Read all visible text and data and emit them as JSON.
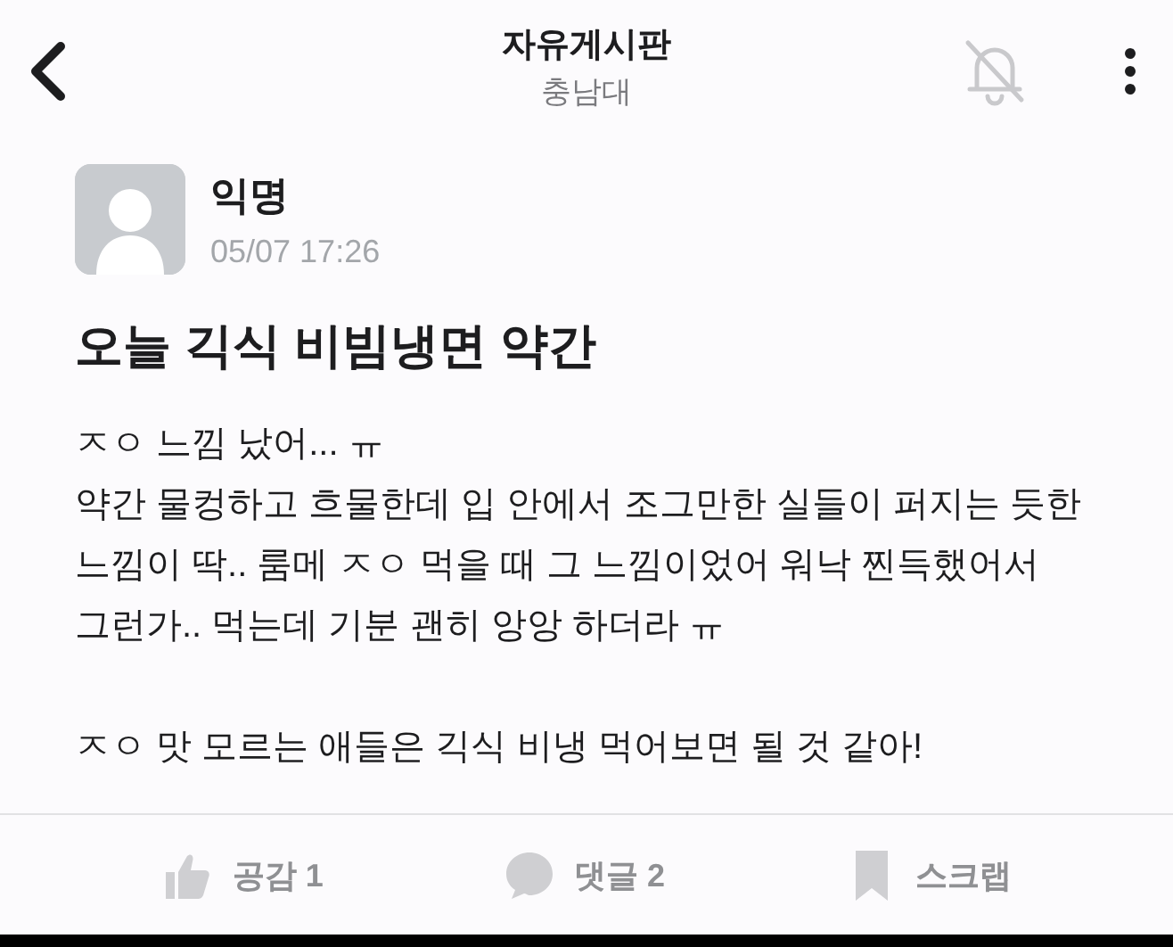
{
  "header": {
    "title": "자유게시판",
    "subtitle": "충남대",
    "notifications_muted": true
  },
  "post": {
    "author": "익명",
    "time": "05/07 17:26",
    "title": "오늘 긱식 비빔냉면 약간",
    "paragraphs": [
      [
        "ㅈㅇ 느낌 났어... ㅠ",
        "약간 물컹하고 흐물한데 입 안에서 조그만한 실들이 퍼지는 듯한",
        "느낌이 딱.. 룸메 ㅈㅇ 먹을 때 그 느낌이었어 워낙 찐득했어서",
        "그런가.. 먹는데 기분 괜히 앙앙 하더라 ㅠ"
      ],
      [
        "ㅈㅇ 맛 모르는 애들은 긱식 비냉 먹어보면 될 것 같아!"
      ]
    ]
  },
  "actions": [
    {
      "kind": "like",
      "label": "공감",
      "count": "1"
    },
    {
      "kind": "comment",
      "label": "댓글",
      "count": "2"
    },
    {
      "kind": "scrap",
      "label": "스크랩"
    }
  ]
}
